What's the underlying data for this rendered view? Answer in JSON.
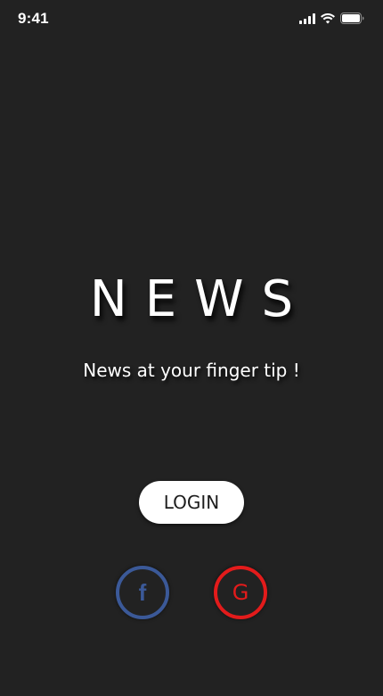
{
  "status_bar": {
    "time": "9:41",
    "icons": [
      "cellular-signal-icon",
      "wifi-icon",
      "battery-icon"
    ]
  },
  "brand": {
    "title": "NEWS",
    "tagline": "News at your finger tip !"
  },
  "auth": {
    "login_label": "LOGIN",
    "social": [
      {
        "icon": "facebook-icon",
        "glyph": "f",
        "color": "#3b5998"
      },
      {
        "icon": "google-icon",
        "glyph": "G",
        "color": "#e31b1b"
      }
    ]
  },
  "colors": {
    "background": "#222222",
    "text": "#ffffff",
    "button_bg": "#ffffff",
    "button_text": "#1d1d1d",
    "facebook": "#3b5998",
    "google": "#e31b1b"
  }
}
